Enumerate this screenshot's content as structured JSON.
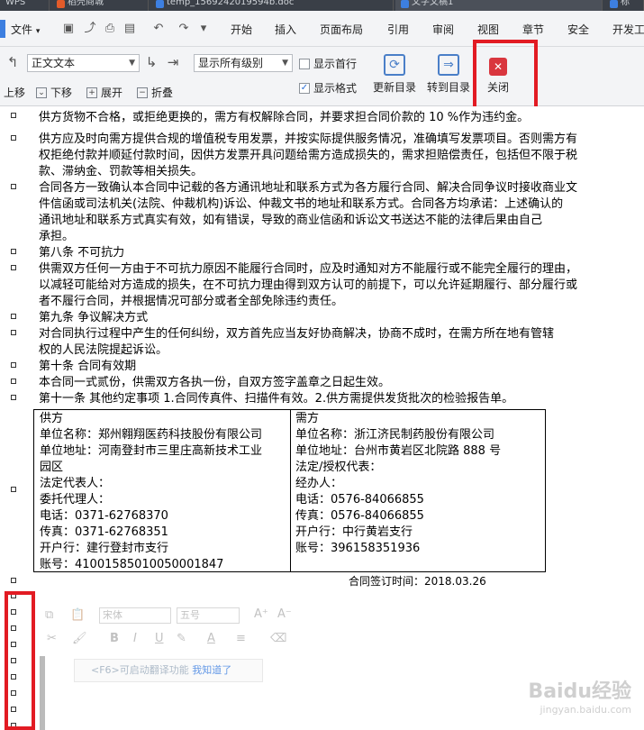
{
  "tabs": [
    "WPS",
    "稻壳商城",
    "temp_1569242019594b.doc",
    "文字文稿1",
    "标"
  ],
  "menu": {
    "file": "文件",
    "items": [
      "开始",
      "插入",
      "页面布局",
      "引用",
      "审阅",
      "视图",
      "章节",
      "安全",
      "开发工"
    ]
  },
  "toolbar": {
    "style_select": "正文文本",
    "level_select": "显示所有级别",
    "show_first_line": "显示首行",
    "show_format": "显示格式",
    "update_toc": "更新目录",
    "goto_toc": "转到目录",
    "close": "关闭",
    "move_up": "上移",
    "move_down": "下移",
    "expand": "展开",
    "collapse": "折叠"
  },
  "doc": {
    "lines": [
      "供方货物不合格，或拒绝更换的，需方有权解除合同，并要求担合同价款的 10 %作为违约金。",
      "供方应及时向需方提供合规的增值税专用发票，并按实际提供服务情况，准确填写发票项目。否则需方有",
      "权拒绝付款并顺延付款时间，因供方发票开具问题给需方造成损失的，需求担赔偿责任，包括但不限于税",
      "款、滞纳金、罚款等相关损失。",
      "合同各方一致确认本合同中记载的各方通讯地址和联系方式为各方履行合同、解决合同争议时接收商业文",
      "件信函或司法机关(法院、仲裁机构)诉讼、仲裁文书的地址和联系方式。合同各方均承诺：上述确认的",
      "通讯地址和联系方式真实有效，如有错误，导致的商业信函和诉讼文书送达不能的法律后果由自己",
      "承担。",
      "第八条  不可抗力",
      "供需双方任何一方由于不可抗力原因不能履行合同时，应及时通知对方不能履行或不能完全履行的理由，",
      "以减轻可能给对方造成的损失，在不可抗力理由得到双方认可的前提下，可以允许延期履行、部分履行或",
      "者不履行合同，并根据情况可部分或者全部免除违约责任。",
      "第九条  争议解决方式",
      "      对合同执行过程中产生的任何纠纷，双方首先应当友好协商解决，协商不成时，在需方所在地有管辖",
      "权的人民法院提起诉讼。",
      "第十条  合同有效期",
      "本合同一式贰份，供需双方各执一份，自双方签字盖章之日起生效。",
      "第十一条  其他约定事项 1.合同传真件、扫描件有效。2.供方需提供发货批次的检验报告单。"
    ],
    "supplier": [
      "供方",
      "单位名称：郑州翱翔医药科技股份有限公司",
      "单位地址：河南登封市三里庄高新技术工业",
      "园区",
      "法定代表人：",
      "委托代理人：",
      "电话：0371-62768370",
      "传真：0371-62768351",
      "开户行：建行登封市支行",
      "账号：41001585010050001847"
    ],
    "buyer": [
      "需方",
      "单位名称：浙江济民制药股份有限公司",
      "单位地址：台州市黄岩区北院路 888 号",
      "法定/授权代表：",
      "经办人：",
      "电话：0576-84066855",
      "传真：0576-84066855",
      "开户行：中行黄岩支行",
      "账号：396158351936"
    ],
    "sign_date": "合同签订时间：2018.03.26"
  },
  "floating_toolbar": {
    "font": "宋体",
    "size": "五号"
  },
  "hint": {
    "text": "<F6>可启动翻译功能",
    "link": "我知道了"
  },
  "watermark": {
    "brand": "Baidu经验",
    "sub": "jingyan.baidu.com"
  },
  "accent": "#e21b23"
}
